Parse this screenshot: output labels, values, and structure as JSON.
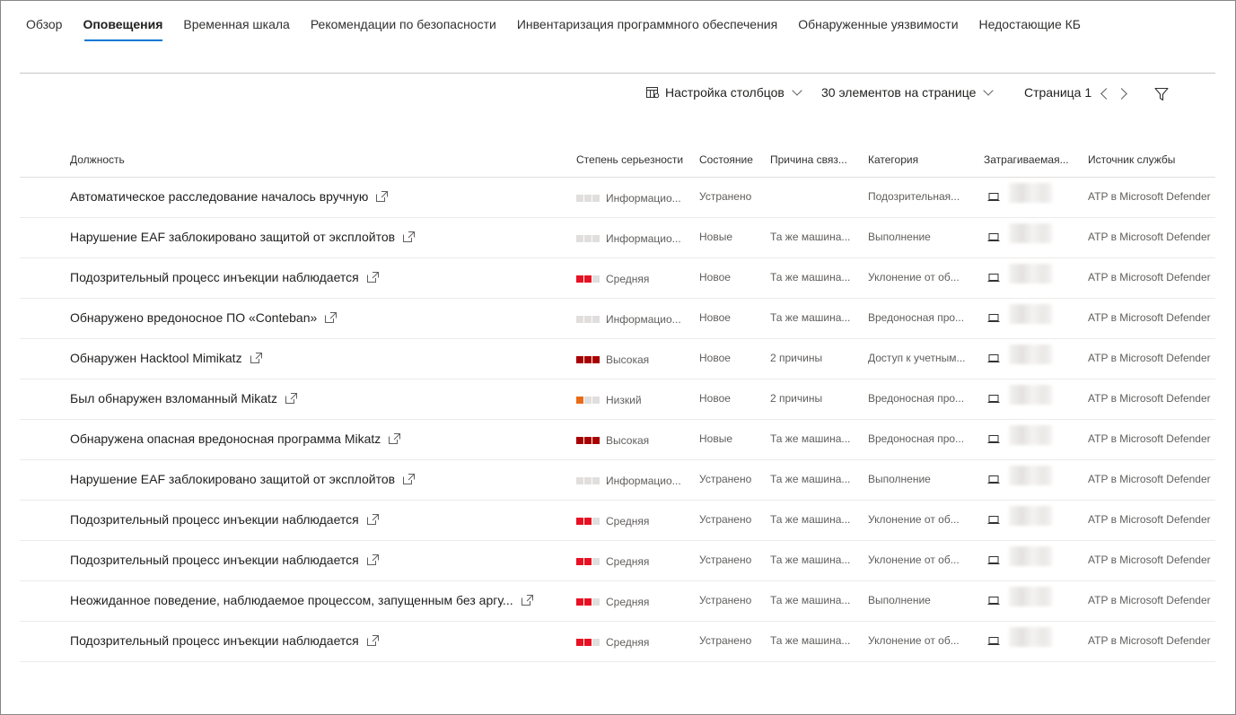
{
  "tabs": [
    {
      "label": "Обзор",
      "active": false
    },
    {
      "label": "Оповещения",
      "active": true
    },
    {
      "label": "Временная шкала",
      "active": false
    },
    {
      "label": "Рекомендации по безопасности",
      "active": false
    },
    {
      "label": "Инвентаризация программного обеспечения",
      "active": false
    },
    {
      "label": "Обнаруженные уязвимости",
      "active": false
    },
    {
      "label": "Недостающие КБ",
      "active": false
    }
  ],
  "toolbar": {
    "columns_label": "Настройка столбцов",
    "page_size_label": "30 элементов на странице",
    "page_label": "Страница 1"
  },
  "table": {
    "headers": [
      "Должность",
      "Степень серьезности",
      "Состояние",
      "Причина связ...",
      "Категория",
      "Затрагиваемая...",
      "Источник службы"
    ],
    "rows": [
      {
        "title": "Автоматическое расследование началось вручную",
        "severity": "Информацио...",
        "severity_level": 0,
        "status": "Устранено",
        "reason": "",
        "category": "Подозрительная...",
        "source": "ATP в Microsoft Defender"
      },
      {
        "title": "Нарушение EAF заблокировано защитой от эксплойтов",
        "severity": "Информацио...",
        "severity_level": 0,
        "status": "Новые",
        "reason": "Та же машина...",
        "category": "Выполнение",
        "source": "ATP в Microsoft Defender"
      },
      {
        "title": "Подозрительный процесс инъекции наблюдается",
        "severity": "Средняя",
        "severity_level": 2,
        "status": "Новое",
        "reason": "Та же машина...",
        "category": "Уклонение от об...",
        "source": "ATP в Microsoft Defender"
      },
      {
        "title": "Обнаружено вредоносное ПО «Conteban»",
        "severity": "Информацио...",
        "severity_level": 0,
        "status": "Новое",
        "reason": "Та же машина...",
        "category": "Вредоносная про...",
        "source": "ATP в Microsoft Defender"
      },
      {
        "title": "Обнаружен Hacktool Mimikatz",
        "severity": "Высокая",
        "severity_level": 3,
        "status": "Новое",
        "reason": "2 причины",
        "category": "Доступ к учетным...",
        "source": "ATP в Microsoft Defender"
      },
      {
        "title": "Был обнаружен взломанный Mikatz",
        "severity": "Низкий",
        "severity_level": 1,
        "status": "Новое",
        "reason": "2 причины",
        "category": "Вредоносная про...",
        "source": "ATP в Microsoft Defender"
      },
      {
        "title": "Обнаружена опасная вредоносная программа Mikatz",
        "severity": "Высокая",
        "severity_level": 3,
        "status": "Новые",
        "reason": "Та же машина...",
        "category": "Вредоносная про...",
        "source": "ATP в Microsoft Defender"
      },
      {
        "title": "Нарушение EAF заблокировано защитой от эксплойтов",
        "severity": "Информацио...",
        "severity_level": 0,
        "status": "Устранено",
        "reason": "Та же машина...",
        "category": "Выполнение",
        "source": "ATP в Microsoft Defender"
      },
      {
        "title": "Подозрительный процесс инъекции наблюдается",
        "severity": "Средняя",
        "severity_level": 2,
        "status": "Устранено",
        "reason": "Та же машина...",
        "category": "Уклонение от об...",
        "source": "ATP в Microsoft Defender"
      },
      {
        "title": "Подозрительный процесс инъекции наблюдается",
        "severity": "Средняя",
        "severity_level": 2,
        "status": "Устранено",
        "reason": "Та же машина...",
        "category": "Уклонение от об...",
        "source": "ATP в Microsoft Defender"
      },
      {
        "title": "Неожиданное поведение, наблюдаемое процессом, запущенным без аргу...",
        "severity": "Средняя",
        "severity_level": 2,
        "status": "Устранено",
        "reason": "Та же машина...",
        "category": "Выполнение",
        "source": "ATP в Microsoft Defender"
      },
      {
        "title": "Подозрительный процесс инъекции наблюдается",
        "severity": "Средняя",
        "severity_level": 2,
        "status": "Устранено",
        "reason": "Та же машина...",
        "category": "Уклонение от об...",
        "source": "ATP в Microsoft Defender"
      }
    ]
  },
  "colors": {
    "accent": "#0078d4",
    "severity_empty": "#e1dfdd",
    "severity_low": "#ea6b17",
    "severity_medium": "#e81123",
    "severity_high": "#a80000"
  },
  "icons": {
    "columns": "column-settings-icon",
    "chevron": "chevron-down-icon",
    "prev": "chevron-left-icon",
    "next": "chevron-right-icon",
    "filter": "filter-icon",
    "open": "open-in-new-icon",
    "device": "laptop-icon"
  }
}
